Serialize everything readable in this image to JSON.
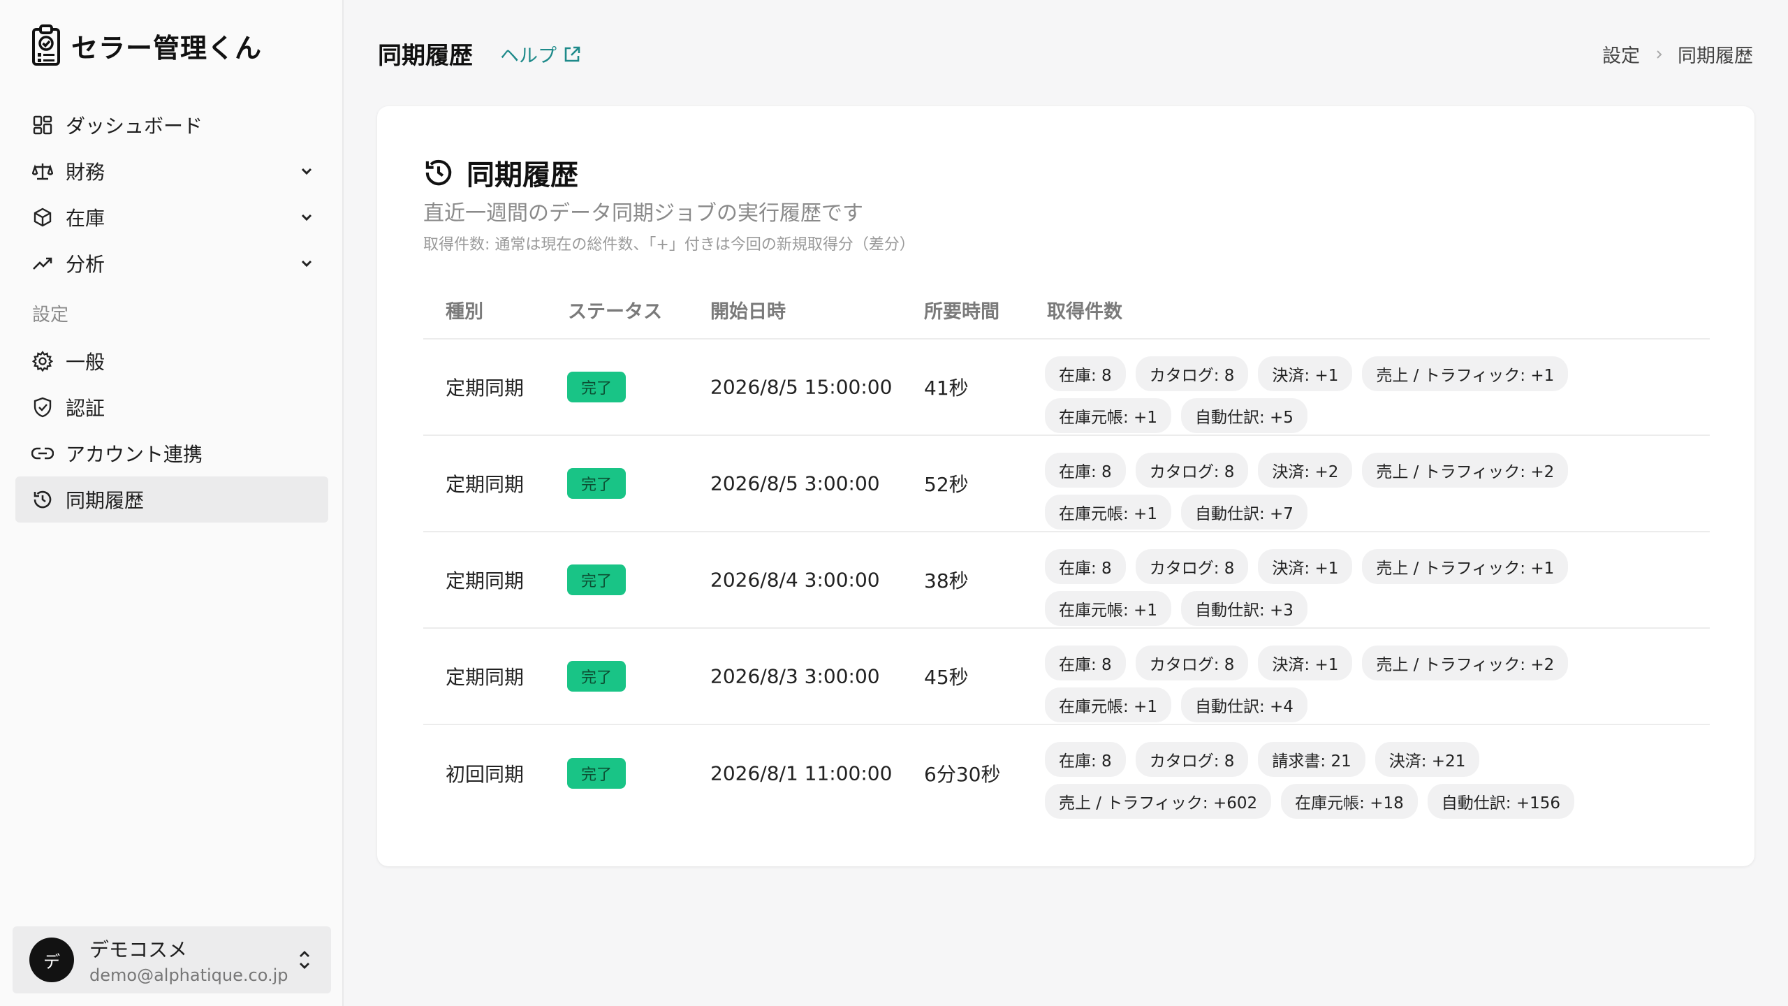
{
  "app": {
    "name": "セラー管理くん"
  },
  "sidebar": {
    "items": [
      {
        "label": "ダッシュボード",
        "icon": "dashboard-icon"
      },
      {
        "label": "財務",
        "icon": "scale-icon",
        "expandable": true
      },
      {
        "label": "在庫",
        "icon": "box-icon",
        "expandable": true
      },
      {
        "label": "分析",
        "icon": "trend-icon",
        "expandable": true
      }
    ],
    "section_label": "設定",
    "settings_items": [
      {
        "label": "一般",
        "icon": "gear-icon"
      },
      {
        "label": "認証",
        "icon": "shield-icon"
      },
      {
        "label": "アカウント連携",
        "icon": "link-icon"
      },
      {
        "label": "同期履歴",
        "icon": "history-icon",
        "active": true
      }
    ],
    "user": {
      "avatar": "デ",
      "name": "デモコスメ",
      "email": "demo@alphatique.co.jp"
    }
  },
  "header": {
    "title": "同期履歴",
    "help_label": "ヘルプ",
    "breadcrumb": [
      "設定",
      "同期履歴"
    ]
  },
  "card": {
    "title": "同期履歴",
    "description": "直近一週間のデータ同期ジョブの実行履歴です",
    "note": "取得件数: 通常は現在の総件数、「+」付きは今回の新規取得分（差分）",
    "columns": [
      "種別",
      "ステータス",
      "開始日時",
      "所要時間",
      "取得件数"
    ],
    "rows": [
      {
        "type": "定期同期",
        "status": "完了",
        "started": "2026/8/5 15:00:00",
        "duration": "41秒",
        "counts": [
          "在庫: 8",
          "カタログ: 8",
          "決済: +1",
          "売上 / トラフィック: +1",
          "在庫元帳: +1",
          "自動仕訳: +5"
        ]
      },
      {
        "type": "定期同期",
        "status": "完了",
        "started": "2026/8/5 3:00:00",
        "duration": "52秒",
        "counts": [
          "在庫: 8",
          "カタログ: 8",
          "決済: +2",
          "売上 / トラフィック: +2",
          "在庫元帳: +1",
          "自動仕訳: +7"
        ]
      },
      {
        "type": "定期同期",
        "status": "完了",
        "started": "2026/8/4 3:00:00",
        "duration": "38秒",
        "counts": [
          "在庫: 8",
          "カタログ: 8",
          "決済: +1",
          "売上 / トラフィック: +1",
          "在庫元帳: +1",
          "自動仕訳: +3"
        ]
      },
      {
        "type": "定期同期",
        "status": "完了",
        "started": "2026/8/3 3:00:00",
        "duration": "45秒",
        "counts": [
          "在庫: 8",
          "カタログ: 8",
          "決済: +1",
          "売上 / トラフィック: +2",
          "在庫元帳: +1",
          "自動仕訳: +4"
        ]
      },
      {
        "type": "初回同期",
        "status": "完了",
        "started": "2026/8/1 11:00:00",
        "duration": "6分30秒",
        "counts": [
          "在庫: 8",
          "カタログ: 8",
          "請求書: 21",
          "決済: +21",
          "売上 / トラフィック: +602",
          "在庫元帳: +18",
          "自動仕訳: +156"
        ]
      }
    ]
  },
  "colors": {
    "accent": "#1e8a8a",
    "success": "#19c486",
    "active_bg": "#ebebec"
  }
}
